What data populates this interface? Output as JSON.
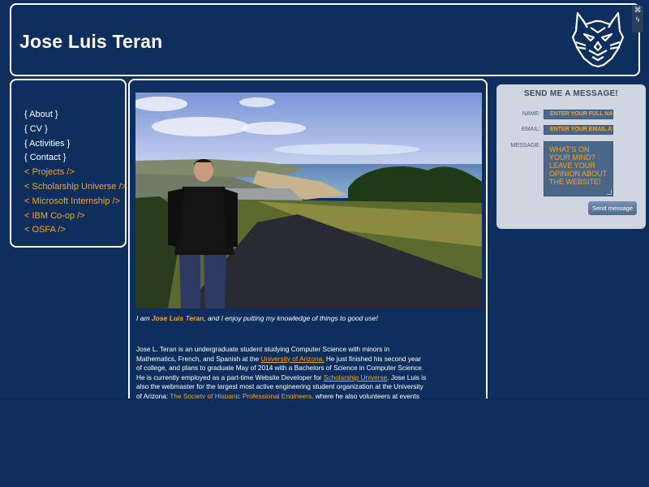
{
  "header": {
    "title": "Jose Luis Teran",
    "logo_icon": "wildcat-logo",
    "corner_icons": [
      "share-icon",
      "bolt-icon"
    ]
  },
  "nav": {
    "items": [
      {
        "label": "{ About }",
        "color": "#ffffff"
      },
      {
        "label": "{ CV }",
        "color": "#ffffff"
      },
      {
        "label": "{ Activities }",
        "color": "#ffffff"
      },
      {
        "label": "{ Contact }",
        "color": "#ffffff"
      },
      {
        "label": "< Projects />",
        "color": "#f7a51e"
      },
      {
        "label": "< Scholarship Universe />",
        "color": "#f7a51e"
      },
      {
        "label": "< Microsoft Internship />",
        "color": "#f7a51e"
      },
      {
        "label": "< IBM Co-op />",
        "color": "#f7a51e"
      },
      {
        "label": "< OSFA />",
        "color": "#f7a51e"
      }
    ]
  },
  "main": {
    "caption": {
      "prefix": "I am ",
      "name": "Jose Luis Teran",
      "suffix": ", and I enjoy putting my knowledge of things to good use!"
    },
    "bio": {
      "t1": "Jose L. Teran is an undergraduate student studying Computer Science with minors in Mathematics, French, and Spanish at the ",
      "link1": "University of Arizona.",
      "t2": " He just finished his second year of college, and plans to graduate May of 2014 with a Bachelors of Science in Computer Science. He is currently employed as a part-time Website Developer for ",
      "link2": "Scholarship Universe",
      "t3": ". Jose Luis is also the webmaster for the largest most active engineering student organization at the University of Arizona: ",
      "link3": "The Society of Hispanic Professional Engineers",
      "t4": ", where he also volunteers at events that help reach out to the"
    }
  },
  "contact": {
    "heading": "SEND ME A MESSAGE!",
    "name_label": "NAME:",
    "name_placeholder": "ENTER YOUR FULL NAME",
    "email_label": "EMAIL:",
    "email_placeholder": "ENTER YOUR EMAIL ADDRESS",
    "message_label": "MESSAGE:",
    "message_placeholder": "WHAT'S ON YOUR MIND? LEAVE YOUR OPINION ABOUT THE WEBSITE!",
    "send_label": "Send message"
  },
  "colors": {
    "background": "#0e2f5e",
    "accent": "#f7a51e",
    "panel": "#cfd6df"
  }
}
